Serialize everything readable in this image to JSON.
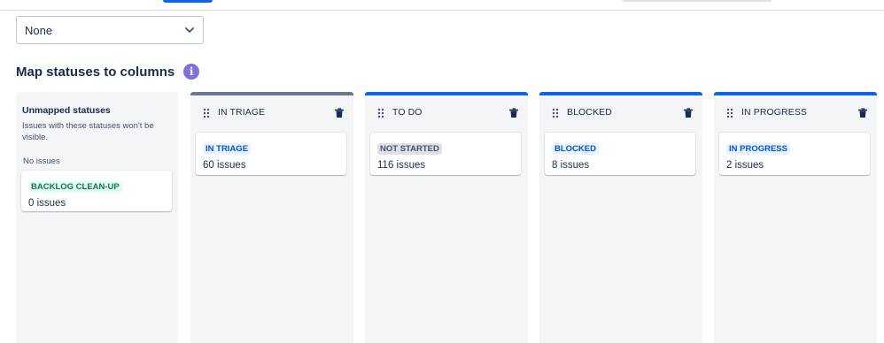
{
  "filter_select": {
    "value": "None",
    "icon": "chevron-down-icon"
  },
  "section": {
    "title": "Map statuses to columns",
    "info_icon": "info-icon"
  },
  "colors": {
    "primary": "#0c66e4",
    "triage_bar": "#6b778c",
    "blue_lozenge_bg": "#e9f2ff",
    "blue_lozenge_fg": "#0055cc",
    "grey_lozenge_bg": "#dfe1e6",
    "grey_lozenge_fg": "#42526e",
    "green_lozenge_bg": "#dcfff1",
    "green_lozenge_fg": "#216e4e",
    "info_purple": "#8270db"
  },
  "unmapped": {
    "title": "Unmapped statuses",
    "description": "Issues with these statuses won't be visible.",
    "no_issues": "No issues",
    "card": {
      "status": "BACKLOG CLEAN-UP",
      "count": "0 issues"
    }
  },
  "columns": [
    {
      "name": "IN TRIAGE",
      "card": {
        "status": "IN TRIAGE",
        "count": "60 issues"
      }
    },
    {
      "name": "TO DO",
      "card": {
        "status": "NOT STARTED",
        "count": "116 issues"
      }
    },
    {
      "name": "BLOCKED",
      "card": {
        "status": "BLOCKED",
        "count": "8 issues"
      }
    },
    {
      "name": "IN PROGRESS",
      "card": {
        "status": "IN PROGRESS",
        "count": "2 issues"
      }
    }
  ]
}
